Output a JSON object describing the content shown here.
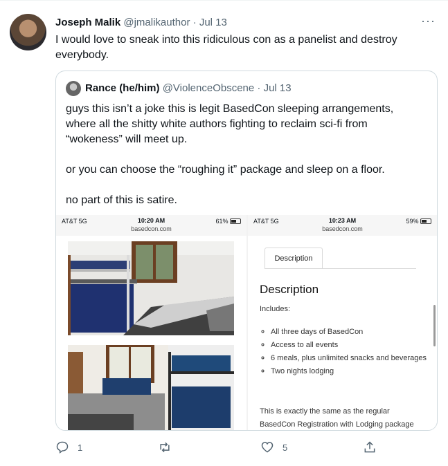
{
  "tweet": {
    "author_name": "Joseph Malik",
    "handle": "@jmalikauthor",
    "separator": "·",
    "date": "Jul 13",
    "text": "I would love to sneak into this ridiculous con as a panelist and destroy everybody.",
    "more_icon": "more-icon",
    "replies": "1",
    "likes": "5"
  },
  "quote": {
    "author_name": "Rance (he/him)",
    "handle": "@ViolenceObscene",
    "separator": "·",
    "date": "Jul 13",
    "paragraphs": [
      "guys this isn’t a joke this is legit BasedCon sleeping arrangements, where all the shitty white authors fighting to reclaim sci-fi from “wokeness” will meet up.",
      "or you can choose the “roughing it” package and sleep on a floor.",
      "no part of this is satire."
    ]
  },
  "screens": {
    "left": {
      "carrier": "AT&T 5G",
      "time": "10:20 AM",
      "url": "basedcon.com",
      "battery": "61%",
      "battery_level": 0.61
    },
    "right": {
      "carrier": "AT&T 5G",
      "time": "10:23 AM",
      "url": "basedcon.com",
      "battery": "59%",
      "battery_level": 0.59
    }
  },
  "product": {
    "tab_label": "Description",
    "heading": "Description",
    "includes_label": "Includes:",
    "items": [
      "All three days of BasedCon",
      "Access to all events",
      "6 meals, plus unlimited snacks and beverages",
      "Two nights lodging"
    ],
    "paragraph": "This is exactly the same as the regular BasedCon Registration with Lodging package with one"
  },
  "colors": {
    "text": "#0f1419",
    "muted": "#536471",
    "border": "#cfd9de"
  }
}
